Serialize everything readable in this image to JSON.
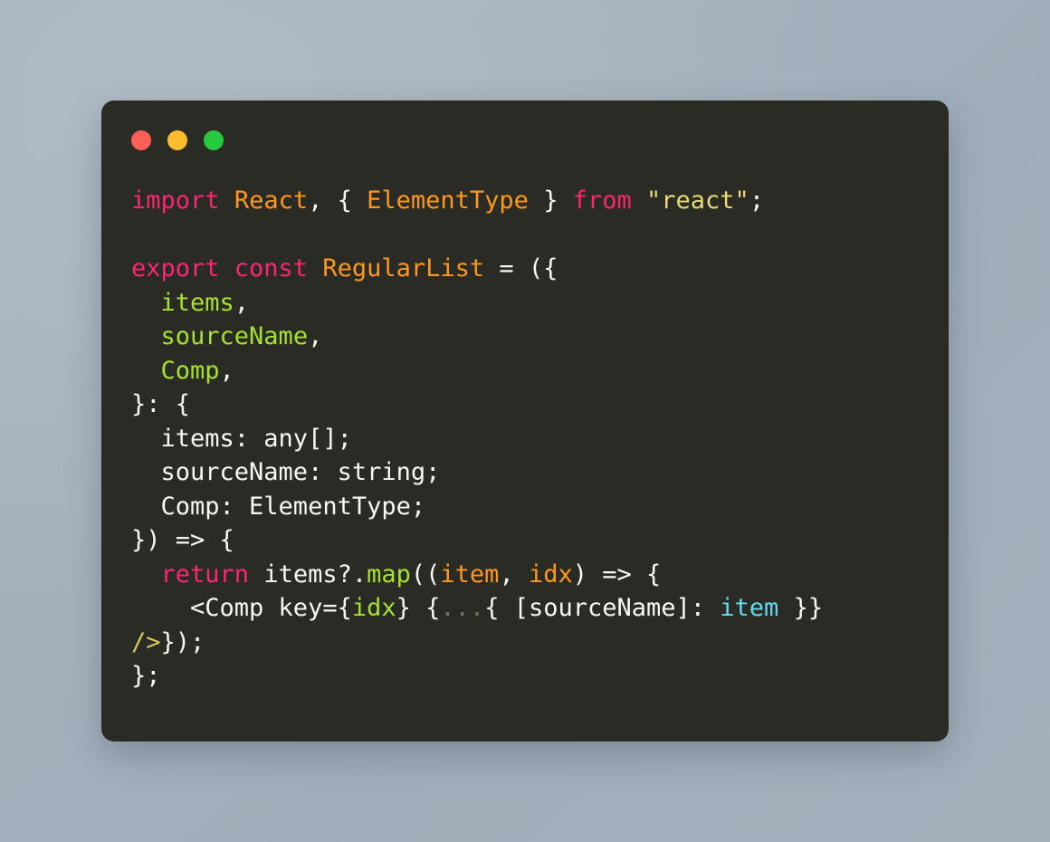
{
  "window": {
    "name": "code-snippet-window",
    "background_color": "#2b2b26",
    "page_background": "#a6b1bd",
    "traffic_lights": [
      {
        "name": "close",
        "color": "#ff5f56"
      },
      {
        "name": "minimize",
        "color": "#ffbd2e"
      },
      {
        "name": "maximize",
        "color": "#27c93f"
      }
    ]
  },
  "theme": {
    "keyword": "#f92672",
    "function": "#fd971f",
    "string": "#e6db74",
    "variable": "#a6e22e",
    "cyan": "#66d9ef",
    "comment": "#75715e",
    "tag": "#d9c75a",
    "plain": "#f8f8f2"
  },
  "code": {
    "language": "tsx",
    "full_text": "import React, { ElementType } from \"react\";\n\nexport const RegularList = ({\n  items,\n  sourceName,\n  Comp,\n}: {\n  items: any[];\n  sourceName: string;\n  Comp: ElementType;\n}) => {\n  return items?.map((item, idx) => {\n    <Comp key={idx} {...{ [sourceName]: item }}\n/>});\n};",
    "lines": [
      {
        "n": 1,
        "tokens": [
          {
            "t": "import",
            "c": "kw"
          },
          {
            "t": " ",
            "c": "plain"
          },
          {
            "t": "React",
            "c": "fn"
          },
          {
            "t": ", { ",
            "c": "plain"
          },
          {
            "t": "ElementType",
            "c": "fn"
          },
          {
            "t": " } ",
            "c": "plain"
          },
          {
            "t": "from",
            "c": "kw"
          },
          {
            "t": " ",
            "c": "plain"
          },
          {
            "t": "\"react\"",
            "c": "str"
          },
          {
            "t": ";",
            "c": "plain"
          }
        ]
      },
      {
        "n": 2,
        "tokens": []
      },
      {
        "n": 3,
        "tokens": [
          {
            "t": "export const",
            "c": "kw"
          },
          {
            "t": " ",
            "c": "plain"
          },
          {
            "t": "RegularList",
            "c": "fn"
          },
          {
            "t": " = ({",
            "c": "plain"
          }
        ]
      },
      {
        "n": 4,
        "tokens": [
          {
            "t": "  ",
            "c": "plain"
          },
          {
            "t": "items",
            "c": "var"
          },
          {
            "t": ",",
            "c": "plain"
          }
        ]
      },
      {
        "n": 5,
        "tokens": [
          {
            "t": "  ",
            "c": "plain"
          },
          {
            "t": "sourceName",
            "c": "var"
          },
          {
            "t": ",",
            "c": "plain"
          }
        ]
      },
      {
        "n": 6,
        "tokens": [
          {
            "t": "  ",
            "c": "plain"
          },
          {
            "t": "Comp",
            "c": "var"
          },
          {
            "t": ",",
            "c": "plain"
          }
        ]
      },
      {
        "n": 7,
        "tokens": [
          {
            "t": "}: {",
            "c": "plain"
          }
        ]
      },
      {
        "n": 8,
        "tokens": [
          {
            "t": "  items: any[];",
            "c": "plain"
          }
        ]
      },
      {
        "n": 9,
        "tokens": [
          {
            "t": "  sourceName: string;",
            "c": "plain"
          }
        ]
      },
      {
        "n": 10,
        "tokens": [
          {
            "t": "  Comp: ElementType;",
            "c": "plain"
          }
        ]
      },
      {
        "n": 11,
        "tokens": [
          {
            "t": "}) => {",
            "c": "plain"
          }
        ]
      },
      {
        "n": 12,
        "tokens": [
          {
            "t": "  ",
            "c": "plain"
          },
          {
            "t": "return",
            "c": "kw"
          },
          {
            "t": " items?.",
            "c": "plain"
          },
          {
            "t": "map",
            "c": "var"
          },
          {
            "t": "((",
            "c": "plain"
          },
          {
            "t": "item",
            "c": "fn"
          },
          {
            "t": ", ",
            "c": "plain"
          },
          {
            "t": "idx",
            "c": "fn"
          },
          {
            "t": ") => {",
            "c": "plain"
          }
        ]
      },
      {
        "n": 13,
        "tokens": [
          {
            "t": "    <Comp key={",
            "c": "plain"
          },
          {
            "t": "idx",
            "c": "var"
          },
          {
            "t": "} {",
            "c": "plain"
          },
          {
            "t": "...",
            "c": "dim"
          },
          {
            "t": "{ [sourceName]: ",
            "c": "plain"
          },
          {
            "t": "item",
            "c": "cyan"
          },
          {
            "t": " }}",
            "c": "plain"
          }
        ]
      },
      {
        "n": 14,
        "tokens": [
          {
            "t": "/>",
            "c": "tag"
          },
          {
            "t": "});",
            "c": "plain"
          }
        ]
      },
      {
        "n": 15,
        "tokens": [
          {
            "t": "};",
            "c": "plain"
          }
        ]
      }
    ]
  }
}
